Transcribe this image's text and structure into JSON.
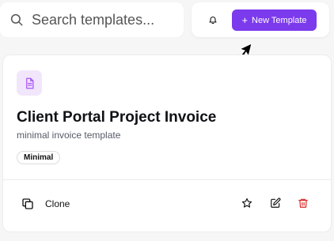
{
  "search": {
    "placeholder": "Search templates..."
  },
  "header": {
    "new_template_label": "New Template"
  },
  "template_card": {
    "title": "Client Portal Project Invoice",
    "subtitle": "minimal invoice template",
    "tag": "Minimal",
    "clone_label": "Clone"
  },
  "icons": {
    "search": "search-icon",
    "bell": "bell-icon",
    "plus": "plus-icon",
    "document": "document-icon",
    "clone": "clone-icon",
    "star": "star-icon",
    "edit": "edit-icon",
    "trash": "trash-icon",
    "cursor": "cursor-arrow-icon"
  },
  "colors": {
    "accent": "#7c3aed",
    "document_icon": "#a855f7",
    "document_icon_bg": "#f1e6fb",
    "danger": "#dc2626"
  }
}
